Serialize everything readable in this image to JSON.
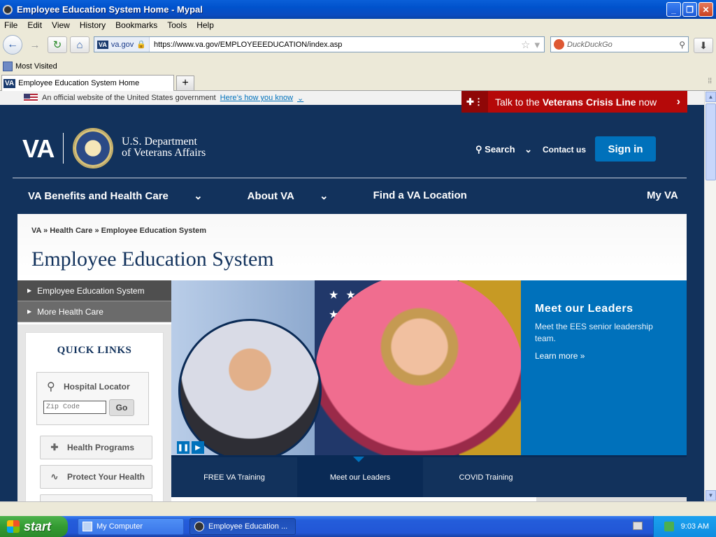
{
  "window": {
    "title": "Employee Education System Home - Mypal",
    "buttons": {
      "minimize": "_",
      "maximize": "❐",
      "close": "✕"
    }
  },
  "menu": [
    "File",
    "Edit",
    "View",
    "History",
    "Bookmarks",
    "Tools",
    "Help"
  ],
  "toolbar": {
    "identity_badge": "VA",
    "identity_domain": "va.gov",
    "url": "https://www.va.gov/EMPLOYEEEDUCATION/index.asp",
    "search_placeholder": "DuckDuckGo"
  },
  "bookmarks": {
    "most_visited": "Most Visited"
  },
  "tab": {
    "badge": "VA",
    "title": "Employee Education System Home",
    "new_tab": "+"
  },
  "gov_banner": {
    "text": "An official website of the United States government",
    "link": "Here’s how you know"
  },
  "crisis_line": {
    "prefix": "Talk to the ",
    "bold": "Veterans Crisis Line",
    "suffix": " now"
  },
  "header": {
    "logo": "VA",
    "dept_line1": "U.S. Department",
    "dept_line2": "of Veterans Affairs",
    "search": "Search",
    "contact": "Contact us",
    "signin": "Sign in"
  },
  "mainnav": {
    "items": [
      "VA Benefits and Health Care",
      "About VA",
      "Find a VA Location"
    ],
    "myva": "My VA"
  },
  "breadcrumb": "VA » Health Care » Employee Education System",
  "page_title": "Employee Education System",
  "sidenav": [
    "Employee Education System",
    "More Health Care"
  ],
  "quick_links": {
    "title": "QUICK LINKS",
    "locator_label": "Hospital Locator",
    "zip_placeholder": "Zip Code",
    "go": "Go",
    "buttons": [
      "Health Programs",
      "Protect Your Health"
    ]
  },
  "hero": {
    "heading": "Meet our Leaders",
    "text": "Meet the EES senior leadership team.",
    "more": "Learn more »",
    "tabs": [
      "FREE VA Training",
      "Meet our Leaders",
      "COVID Training"
    ]
  },
  "taskbar": {
    "start": "start",
    "items": [
      "My Computer",
      "Employee Education ..."
    ],
    "clock": "9:03 AM"
  }
}
